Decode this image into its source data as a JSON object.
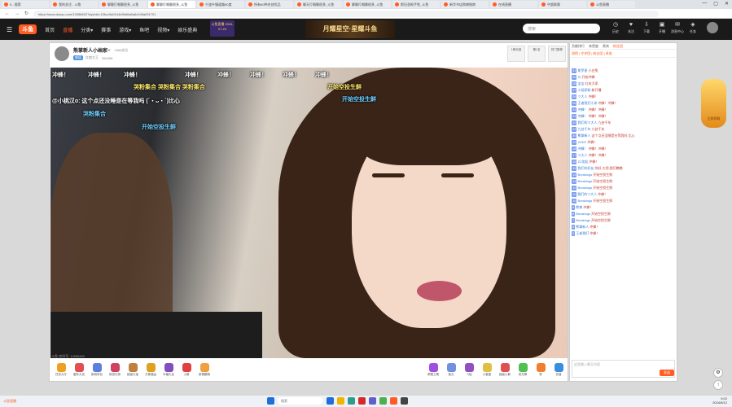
{
  "browser": {
    "tabs": [
      {
        "label": "5 - 搜索",
        "active": false
      },
      {
        "label": "我的关注 - 斗鱼",
        "active": false
      },
      {
        "label": "聊聊打唱聊很多_斗鱼",
        "active": false
      },
      {
        "label": "聊聊打唱聊很多_斗鱼",
        "active": true
      },
      {
        "label": "宁波乡镇道路60度",
        "active": false
      },
      {
        "label": "所有60种名创优品",
        "active": false
      },
      {
        "label": "聊天打唱聊很多_斗鱼",
        "active": false
      },
      {
        "label": "聊聊打唱聊很多_斗鱼",
        "active": false
      },
      {
        "label": "斯坦圣枪手鱼_斗鱼",
        "active": false
      },
      {
        "label": "新华书店购物指南",
        "active": false
      },
      {
        "label": "在线直播",
        "active": false
      },
      {
        "label": "中超联赛",
        "active": false
      },
      {
        "label": "斗鱼直播",
        "active": false
      }
    ],
    "window_controls": [
      "—",
      "▢",
      "✕"
    ],
    "url": "https://www.douyu.com/12658402?dyshid=136cc9a0144e5b66a6a6c2d5a001701"
  },
  "site_header": {
    "logo": "斗鱼",
    "nav": [
      {
        "label": "首页",
        "active": false
      },
      {
        "label": "直播",
        "active": true
      },
      {
        "label": "分类▾",
        "active": false
      },
      {
        "label": "赛事",
        "active": false
      },
      {
        "label": "游戏▾",
        "active": false
      },
      {
        "label": "鱼吧",
        "active": false
      },
      {
        "label": "视频▾",
        "active": false
      },
      {
        "label": "娱乐盛典",
        "active": false
      }
    ],
    "promo_text": "斗鱼直播 2024-07-24",
    "banner_text": "月耀星空·星耀斗鱼",
    "search_placeholder": "搜索",
    "icons": [
      {
        "name": "history",
        "glyph": "◷",
        "label": "历史"
      },
      {
        "name": "follow",
        "glyph": "♥",
        "label": "关注"
      },
      {
        "name": "download",
        "glyph": "⇩",
        "label": "下载"
      },
      {
        "name": "broadcast",
        "glyph": "▣",
        "label": "开播"
      },
      {
        "name": "message",
        "glyph": "✉",
        "label": "消息中心"
      },
      {
        "name": "vip",
        "glyph": "◈",
        "label": "任务"
      }
    ]
  },
  "streamer": {
    "name": "熊掌新人小画家~",
    "follow_count": "1568关注",
    "tag": "颜值",
    "sub_label": "红娘大王",
    "viewers": "284408",
    "side_buttons": [
      "1荣光选",
      "第1名",
      "热门推荐"
    ]
  },
  "danmu": [
    {
      "text": "冲蜂！",
      "style": "white"
    },
    {
      "text": "冲蜂！",
      "style": "white"
    },
    {
      "text": "冲蜂！",
      "style": "white"
    },
    {
      "text": "冲蜂！",
      "style": "white"
    },
    {
      "text": "冲蜂！",
      "style": "white"
    },
    {
      "text": "冲蜂！",
      "style": "white"
    },
    {
      "text": "冲蜂！",
      "style": "white"
    },
    {
      "text": "冲蜂！",
      "style": "white"
    },
    {
      "text": "哭粉集合 哭粉集合 哭粉集合",
      "style": "yellow"
    },
    {
      "text": "开始空投生鲜",
      "style": "yellow"
    },
    {
      "text": "@小桃汉o: 这个点还没睡是在等我吗 (´・ᴗ・`)比心",
      "style": "white"
    },
    {
      "text": "开始空投生鲜",
      "style": "blue"
    },
    {
      "text": "哭粉集合",
      "style": "blue"
    },
    {
      "text": "开始空投生鲜",
      "style": "blue"
    }
  ],
  "video_footer": "斗鱼 房间号: 12658402",
  "gifts": [
    {
      "label": "任务大厅",
      "color": "#f0a020"
    },
    {
      "label": "星际大赏",
      "color": "#e05050"
    },
    {
      "label": "新城背包",
      "color": "#5a7fe0"
    },
    {
      "label": "夜游礼物",
      "color": "#d04060"
    },
    {
      "label": "超级大宝",
      "color": "#c08040"
    },
    {
      "label": "万象福运",
      "color": "#e0a020"
    },
    {
      "label": "半塘礼包",
      "color": "#8050c0"
    },
    {
      "label": "火箭",
      "color": "#e04040"
    },
    {
      "label": "新蛋鹏翔",
      "color": "#f0a040"
    }
  ],
  "gifts_right": [
    {
      "label": "荣耀之鹰",
      "color": "#a050e0"
    },
    {
      "label": "鱼丸",
      "color": "#7090e0"
    },
    {
      "label": "飞船",
      "color": "#9050c0"
    },
    {
      "label": "小星星",
      "color": "#e0c040"
    },
    {
      "label": "超级火箭",
      "color": "#e05050"
    },
    {
      "label": "荧光棒",
      "color": "#50c050"
    },
    {
      "label": "赞",
      "color": "#f08030"
    },
    {
      "label": "充值",
      "color": "#3a8ee0"
    }
  ],
  "chat": {
    "tabs": [
      "贡献排行",
      "亲密度",
      "贵宾",
      "粉丝团"
    ],
    "active_tab": "粉丝团",
    "top_notice": "周榜 | 守护团 | 粉丝团 | 贵族",
    "messages": [
      {
        "lv": "31",
        "name": "斯罗星",
        "text": "小白兔"
      },
      {
        "lv": "30",
        "name": "川",
        "text": "开始冲蜂"
      },
      {
        "lv": "28",
        "name": "宝宝",
        "text": "红米大家"
      },
      {
        "lv": "27",
        "name": "小画家粉",
        "text": "新开播"
      },
      {
        "lv": "26",
        "name": "ツ大人",
        "text": "冲蜂！"
      },
      {
        "lv": "25",
        "name": "王者我们小米",
        "text": "冲蜂！冲蜂！"
      },
      {
        "lv": "24",
        "name": "冲蜂！",
        "text": "冲蜂！冲蜂！"
      },
      {
        "lv": "23",
        "name": "冲蜂！",
        "text": "冲蜂！冲蜂！"
      },
      {
        "lv": "22",
        "name": "我们的ツ大人",
        "text": "九芸千年"
      },
      {
        "lv": "21",
        "name": "九芸千年",
        "text": "九芸千年"
      },
      {
        "lv": "20",
        "name": "熊掌新人",
        "text": "这个点还没睡是在等我吗 比心"
      },
      {
        "lv": "19",
        "name": "ZUNY",
        "text": "冲蜂！"
      },
      {
        "lv": "18",
        "name": "冲蜂！",
        "text": "冲蜂！冲蜂！"
      },
      {
        "lv": "17",
        "name": "ツ大人",
        "text": "冲蜂！冲蜂！"
      },
      {
        "lv": "16",
        "name": "ZZ发起",
        "text": "冲蜂！"
      },
      {
        "lv": "15",
        "name": "我们的好友",
        "text": "你好,大把,我们瞧瞧"
      },
      {
        "lv": "14",
        "name": "Breakings",
        "text": "开始空投生鲜"
      },
      {
        "lv": "13",
        "name": "Breakings",
        "text": "开始空投生鲜"
      },
      {
        "lv": "12",
        "name": "Breakings",
        "text": "开始空投生鲜"
      },
      {
        "lv": "11",
        "name": "我们的ツ大人",
        "text": "冲蜂！"
      },
      {
        "lv": "10",
        "name": "Breakings",
        "text": "开始空投生鲜"
      },
      {
        "lv": "9",
        "name": "熊掌",
        "text": "冲蜂！"
      },
      {
        "lv": "8",
        "name": "Breakings",
        "text": "开始空投生鲜"
      },
      {
        "lv": "7",
        "name": "Breakings",
        "text": "开始空投生鲜"
      },
      {
        "lv": "6",
        "name": "熊掌新人",
        "text": "冲蜂！"
      },
      {
        "lv": "5",
        "name": "王者我们",
        "text": "冲蜂！"
      }
    ],
    "input_placeholder": "这里输入聊天内容",
    "send_label": "发送"
  },
  "side_badge": "立即领取",
  "taskbar": {
    "brand": "斗鱼直播",
    "search_placeholder": "搜索",
    "clock_time": "0:02",
    "clock_date": "2024/8/12",
    "icon_colors": [
      "#1e6fd9",
      "#f2b400",
      "#2a9d8f",
      "#d62828",
      "#5e60ce",
      "#4caf50",
      "#ff5d23",
      "#444"
    ]
  }
}
